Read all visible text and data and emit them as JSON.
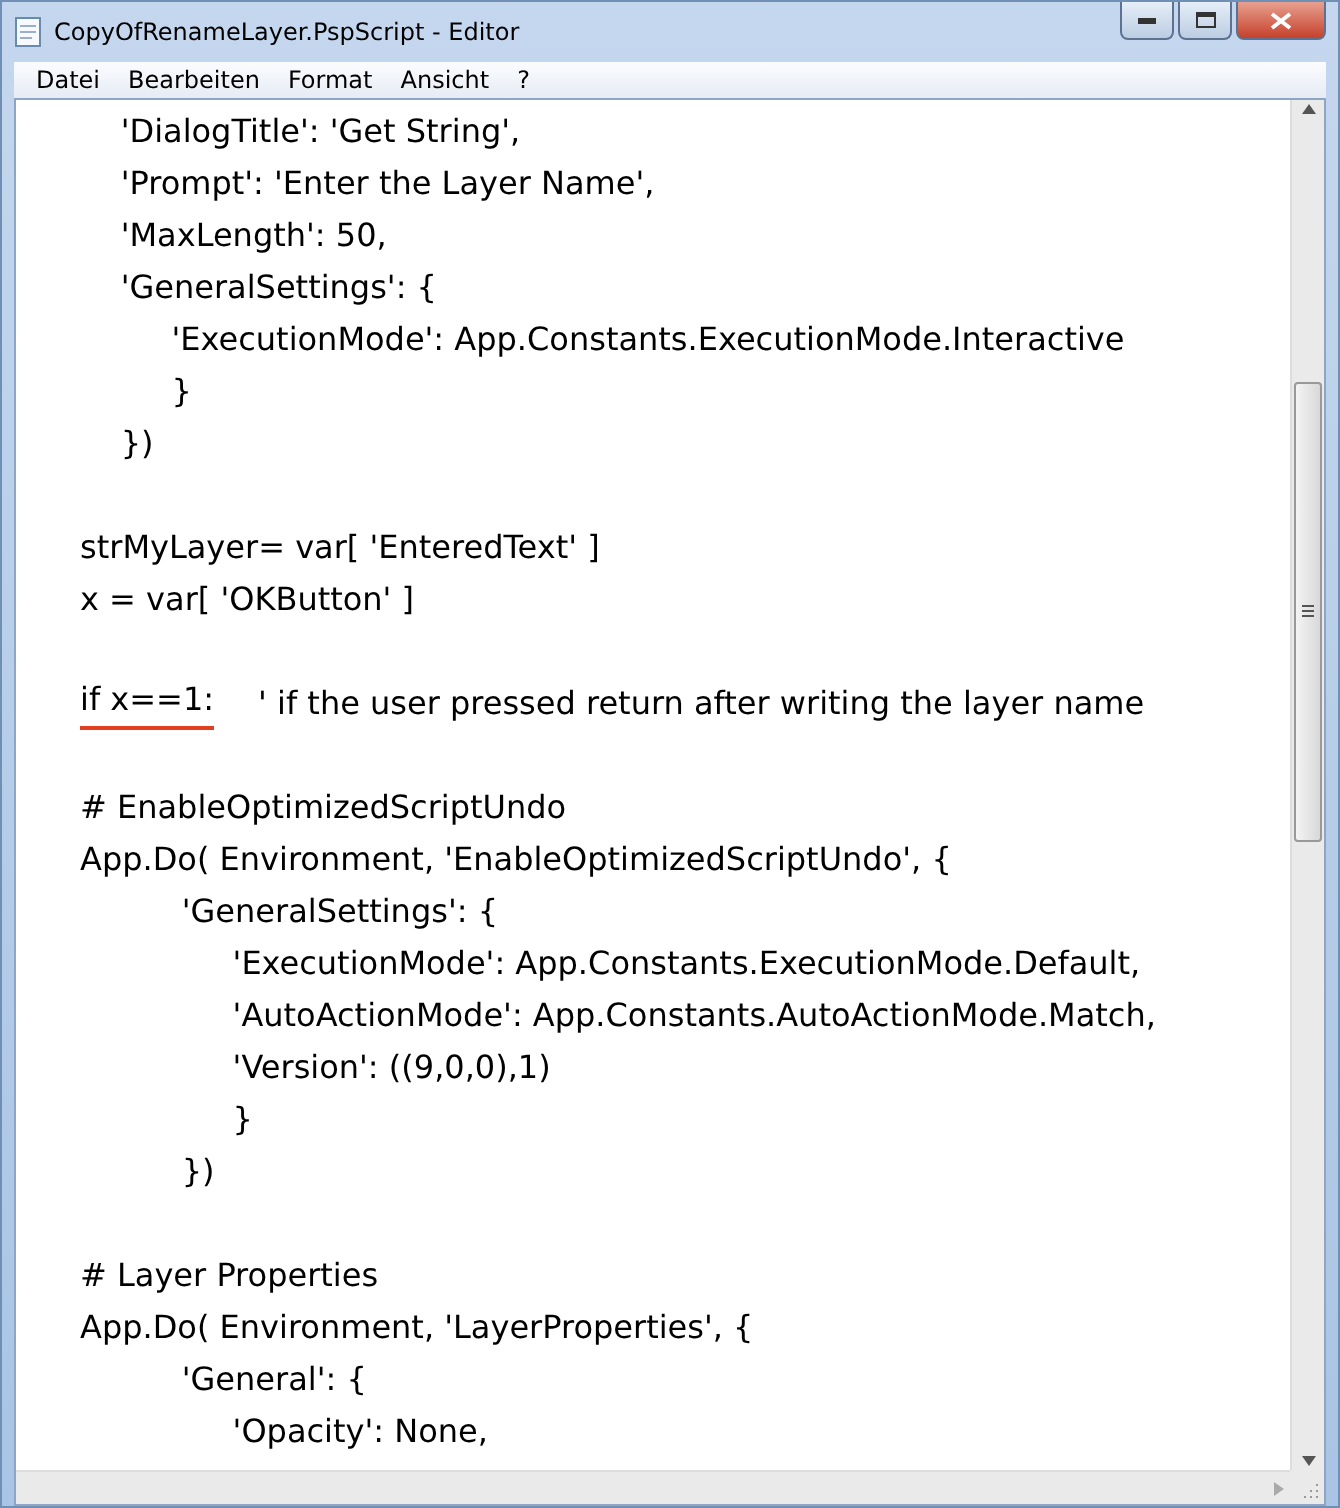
{
  "window": {
    "title": "CopyOfRenameLayer.PspScript - Editor"
  },
  "menu": [
    {
      "label": "Datei"
    },
    {
      "label": "Bearbeiten"
    },
    {
      "label": "Format"
    },
    {
      "label": "Ansicht"
    },
    {
      "label": "?"
    }
  ],
  "editor": {
    "lines": [
      {
        "text": "    'DialogTitle': 'Get String',"
      },
      {
        "text": "    'Prompt': 'Enter the Layer Name',"
      },
      {
        "text": "    'MaxLength': 50,"
      },
      {
        "text": "    'GeneralSettings': {"
      },
      {
        "text": "         'ExecutionMode': App.Constants.ExecutionMode.Interactive"
      },
      {
        "text": "         }"
      },
      {
        "text": "    })"
      },
      {
        "text": "strMyLayer= var[ 'EnteredText' ]",
        "blank_before": true
      },
      {
        "text": "x = var[ 'OKButton' ]"
      },
      {
        "text": "if x==1:",
        "underlined": true,
        "comment": "' if the user pressed return after writing the layer name",
        "blank_before": true
      },
      {
        "text": "# EnableOptimizedScriptUndo",
        "blank_before": true
      },
      {
        "text": "App.Do( Environment, 'EnableOptimizedScriptUndo', {"
      },
      {
        "text": "          'GeneralSettings': {"
      },
      {
        "text": "               'ExecutionMode': App.Constants.ExecutionMode.Default,"
      },
      {
        "text": "               'AutoActionMode': App.Constants.AutoActionMode.Match,"
      },
      {
        "text": "               'Version': ((9,0,0),1)"
      },
      {
        "text": "               }"
      },
      {
        "text": "          })"
      },
      {
        "text": "# Layer Properties",
        "blank_before": true
      },
      {
        "text": "App.Do( Environment, 'LayerProperties', {"
      },
      {
        "text": "          'General': {"
      },
      {
        "text": "               'Opacity': None,"
      }
    ]
  }
}
